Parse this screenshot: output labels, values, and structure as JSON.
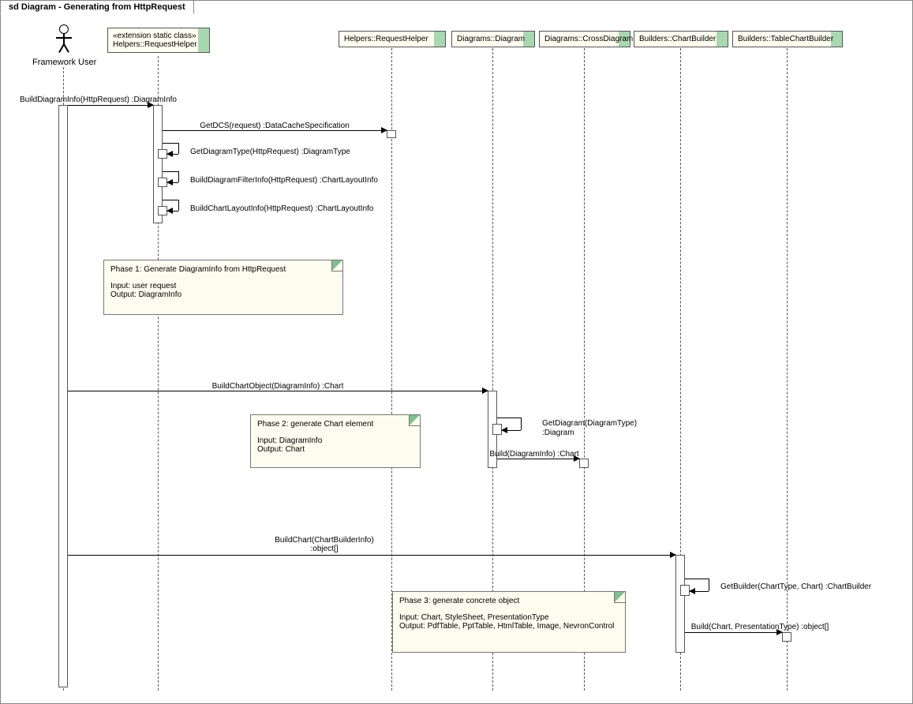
{
  "frame_title_prefix": "sd ",
  "frame_title": "Diagram - Generating from HttpRequest",
  "actor": {
    "label": "Framework User"
  },
  "participants": {
    "p1_stereo": "«extension static class»",
    "p1": "Helpers::RequestHelper",
    "p2": "Helpers::RequestHelper",
    "p3": "Diagrams::Diagram",
    "p4": "Diagrams::CrossDiagram",
    "p5": "Builders::ChartBuilder",
    "p6": "Builders::TableChartBuilder"
  },
  "messages": {
    "m1": "BuildDiagramInfo(HttpRequest) :DiagramInfo",
    "m2": "GetDCS(request) :DataCacheSpecification",
    "m3": "GetDiagramType(HttpRequest) :DiagramType",
    "m4": "BuildDiagramFilterInfo(HttpRequest) :ChartLayoutInfo",
    "m5": "BuildChartLayoutInfo(HttpRequest) :ChartLayoutInfo",
    "m6": "BuildChartObject(DiagramInfo) :Chart",
    "m7a": "GetDiagram(DiagramType)",
    "m7b": ":Diagram",
    "m8": "Build(DiagramInfo) :Chart",
    "m9a": "BuildChart(ChartBuilderInfo)",
    "m9b": ":object[]",
    "m10": "GetBuilder(ChartType, Chart) :ChartBuilder",
    "m11": "Build(Chart, PresentationType) :object[]"
  },
  "notes": {
    "n1_title": "Phase 1: Generate DiagramInfo from HttpRequest",
    "n1_l1": "Input: user request",
    "n1_l2": "Output: DiagramInfo",
    "n2_title": "Phase 2: generate Chart element",
    "n2_l1": "Input: DiagramInfo",
    "n2_l2": "Output: Chart",
    "n3_title": "Phase 3: generate concrete object",
    "n3_l1": "Input: Chart, StyleSheet, PresentationType",
    "n3_l2": "Output: PdfTable, PptTable, HtmlTable, Image, NevronControl"
  }
}
